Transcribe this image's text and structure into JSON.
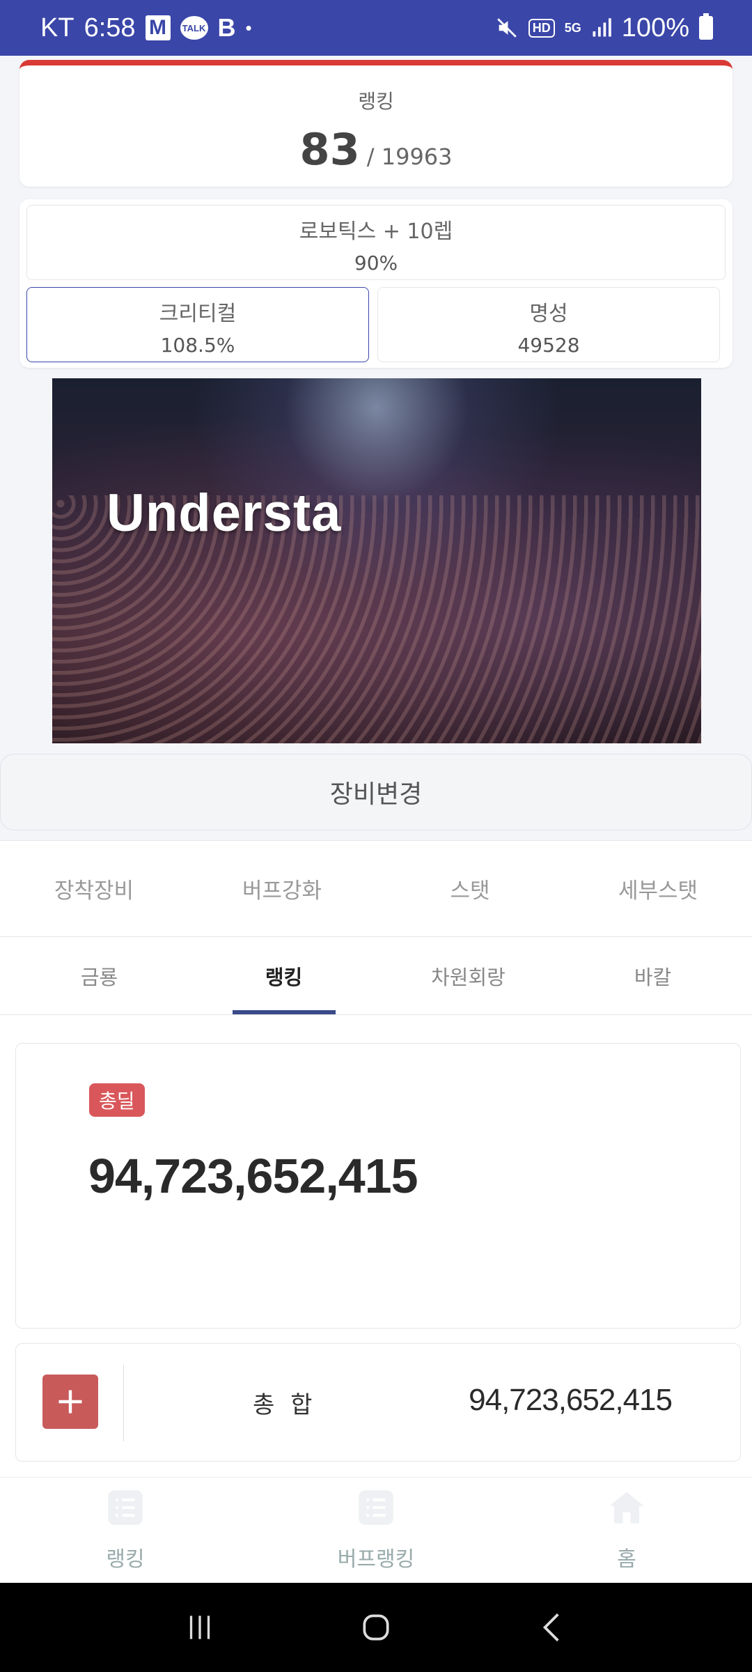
{
  "status_bar": {
    "carrier": "KT",
    "time": "6:58",
    "notif_m": "M",
    "notif_talk": "TALK",
    "notif_b": "B",
    "notif_dot": "•",
    "hd": "HD",
    "net": "5G",
    "battery": "100%"
  },
  "ranking": {
    "label": "랭킹",
    "rank": "83",
    "total": "/ 19963"
  },
  "stats": {
    "robotics": {
      "label": "로보틱스 + 10렙",
      "value": "90%"
    },
    "critical": {
      "label": "크리티컬",
      "value": "108.5%"
    },
    "fame": {
      "label": "명성",
      "value": "49528"
    }
  },
  "video": {
    "caption": "Understa"
  },
  "equip_button": "장비변경",
  "main_tabs": [
    "장착장비",
    "버프강화",
    "스탯",
    "세부스탯"
  ],
  "sub_tabs": [
    "금룡",
    "랭킹",
    "차원회랑",
    "바칼"
  ],
  "active_sub_tab": 1,
  "deal": {
    "badge": "총딜",
    "value": "94,723,652,415"
  },
  "sum": {
    "label": "총 합",
    "value": "94,723,652,415"
  },
  "bottom_nav": [
    {
      "label": "랭킹",
      "icon": "list-icon"
    },
    {
      "label": "버프랭킹",
      "icon": "list-icon"
    },
    {
      "label": "홈",
      "icon": "home-icon"
    }
  ],
  "colors": {
    "status_bar": "#3a46a8",
    "accent_red": "#d93a35",
    "badge_red": "#d9575a",
    "tab_indicator": "#3a4a8a"
  }
}
